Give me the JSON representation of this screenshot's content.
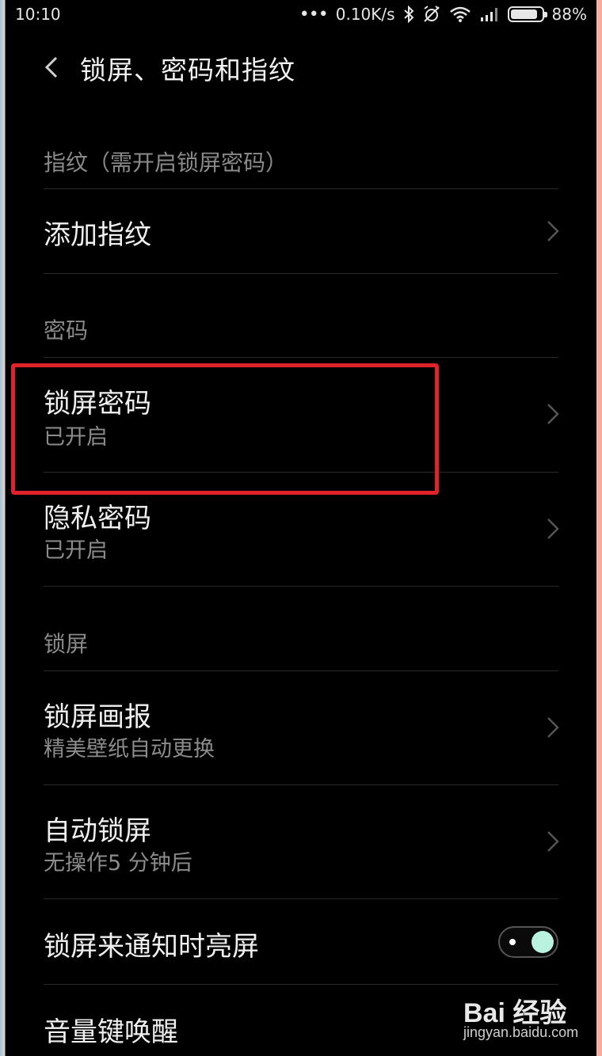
{
  "status_bar": {
    "time": "10:10",
    "net_speed": "0.10K/s",
    "battery_text": "88%",
    "battery_level": 0.88
  },
  "header": {
    "title": "锁屏、密码和指纹"
  },
  "sections": {
    "fingerprint": {
      "label": "指纹（需开启锁屏密码）",
      "add_fingerprint": "添加指纹"
    },
    "password": {
      "label": "密码",
      "lock_password": {
        "title": "锁屏密码",
        "subtitle": "已开启"
      },
      "privacy_password": {
        "title": "隐私密码",
        "subtitle": "已开启"
      }
    },
    "lockscreen": {
      "label": "锁屏",
      "wallpaper": {
        "title": "锁屏画报",
        "subtitle": "精美壁纸自动更换"
      },
      "auto_lock": {
        "title": "自动锁屏",
        "subtitle": "无操作5 分钟后"
      },
      "notify_wake": {
        "title": "锁屏来通知时亮屏",
        "enabled": true
      },
      "volume_wake": {
        "title": "音量键唤醒"
      }
    }
  },
  "highlight_color": "#e0222a",
  "toggle_color": "#b9f3e0",
  "watermark": {
    "logo": "Bai 经验",
    "sub": "jingyan.baidu.com"
  }
}
